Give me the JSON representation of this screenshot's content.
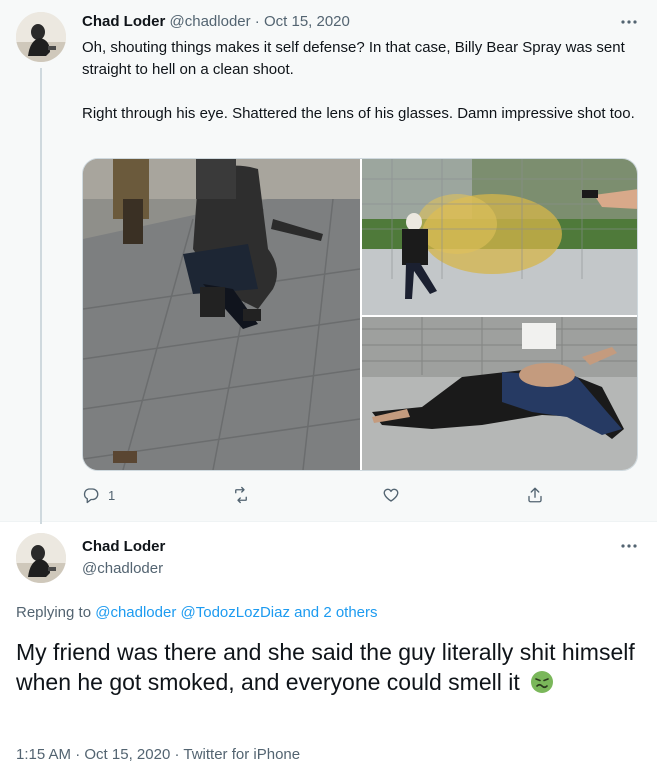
{
  "tweet1": {
    "author_name": "Chad Loder",
    "author_handle": "@chadloder",
    "separator": "·",
    "date": "Oct 15, 2020",
    "paragraph1": "Oh, shouting things makes it self defense? In that case, Billy Bear Spray was sent straight to hell on a clean shoot.",
    "paragraph2": "Right through his eye. Shattered the lens of his glasses. Damn impressive shot too.",
    "reply_count": "1",
    "retweet_count": "",
    "like_count": "",
    "more_icon": "more-dots-icon",
    "media": [
      "photo-crouching-man",
      "photo-spray-shooting",
      "photo-man-on-ground"
    ]
  },
  "tweet2": {
    "author_name": "Chad Loder",
    "author_handle": "@chadloder",
    "replying_prefix": "Replying to ",
    "replying_user1": "@chadloder",
    "replying_user2": "@TodozLozDiaz",
    "replying_suffix": " and 2 others",
    "text": "My friend was there and she said the guy literally shit himself when he got smoked, and everyone could smell it",
    "emoji": "nauseated-face-emoji",
    "time": "1:15 AM",
    "date": "Oct 15, 2020",
    "source": "Twitter for iPhone",
    "separator": "·"
  },
  "colors": {
    "link": "#1d9bf0",
    "secondary_text": "#536471",
    "primary_text": "#0f1419",
    "highlight_bg": "#f7f9f9"
  }
}
